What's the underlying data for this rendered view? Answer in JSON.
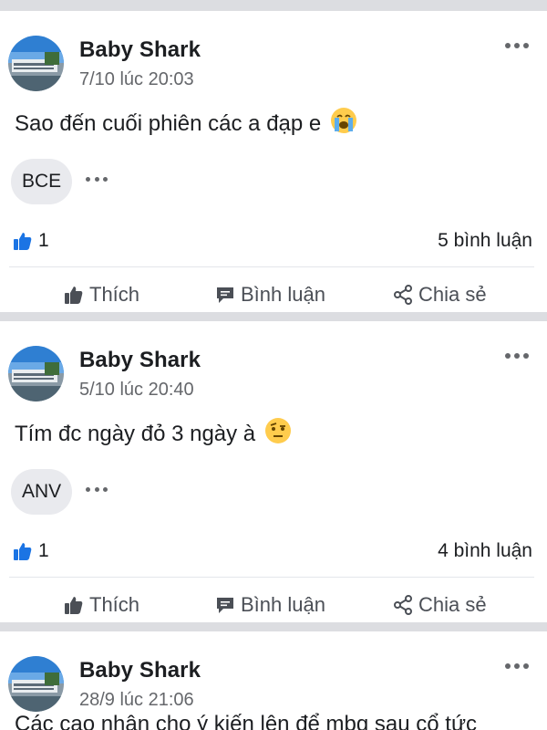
{
  "posts": [
    {
      "author": "Baby Shark",
      "timestamp": "7/10 lúc 20:03",
      "text": "Sao đến cuối phiên các a đạp e",
      "emoji": "loudly-crying-face",
      "tag": "BCE",
      "like_count": "1",
      "comment_count": "5 bình luận"
    },
    {
      "author": "Baby Shark",
      "timestamp": "5/10 lúc 20:40",
      "text": "Tím đc ngày đỏ 3 ngày à",
      "emoji": "face-with-raised-eyebrow",
      "tag": "ANV",
      "like_count": "1",
      "comment_count": "4 bình luận"
    },
    {
      "author": "Baby Shark",
      "timestamp": "28/9 lúc 21:06",
      "text": "Các cao nhân cho ý kiến lên để mbg sau cổ tức",
      "emoji": "",
      "tag": "",
      "like_count": "",
      "comment_count": ""
    }
  ],
  "actions": {
    "like_label": "Thích",
    "comment_label": "Bình luận",
    "share_label": "Chia sẻ"
  },
  "colors": {
    "background": "#dcdde1",
    "card": "#ffffff",
    "like_blue": "#1b74e4",
    "secondary_text": "#65676b"
  }
}
